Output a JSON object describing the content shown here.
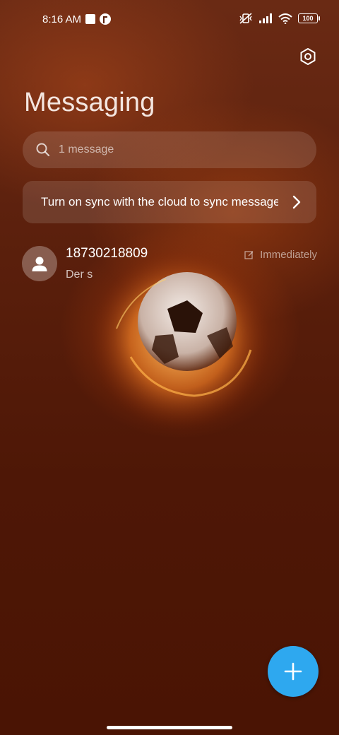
{
  "status_bar": {
    "time": "8:16 AM",
    "battery": "100"
  },
  "header": {
    "title": "Messaging",
    "settings_icon": "gear-icon"
  },
  "search": {
    "placeholder": "1 message"
  },
  "sync_banner": {
    "text": "Turn on sync with the cloud to sync messages"
  },
  "conversations": [
    {
      "sender": "18730218809",
      "preview": "Der s",
      "time": "Immediately"
    }
  ],
  "fab": {
    "icon": "plus-icon",
    "color": "#2ea8ef"
  }
}
